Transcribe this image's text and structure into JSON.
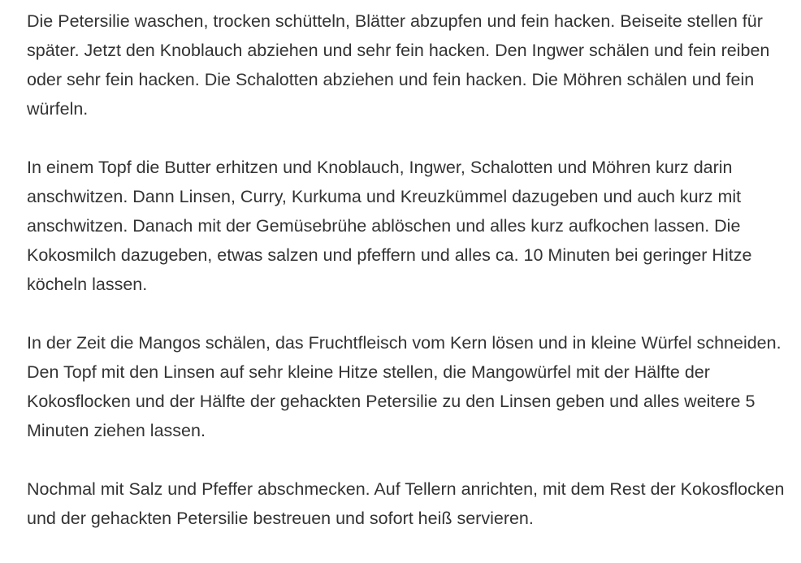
{
  "instructions": {
    "paragraphs": [
      "Die Petersilie waschen, trocken schütteln, Blätter abzupfen und fein hacken. Beiseite stellen für später. Jetzt den Knoblauch abziehen und sehr fein hacken. Den Ingwer schälen und fein reiben oder sehr fein hacken. Die Schalotten abziehen und fein hacken. Die Möhren schälen und fein würfeln.",
      "In einem Topf die Butter erhitzen und Knoblauch, Ingwer, Schalotten und Möhren kurz darin anschwitzen. Dann Linsen, Curry, Kurkuma und Kreuzkümmel dazugeben und auch kurz mit anschwitzen. Danach mit der Gemüsebrühe ablöschen und alles kurz aufkochen lassen. Die Kokosmilch dazugeben, etwas salzen und pfeffern und alles ca. 10 Minuten bei geringer Hitze köcheln lassen.",
      "In der Zeit die Mangos schälen, das Fruchtfleisch vom Kern lösen und in kleine Würfel schneiden. Den Topf mit den Linsen auf sehr kleine Hitze stellen, die Mangowürfel mit der Hälfte der Kokosflocken und der Hälfte der gehackten Petersilie zu den Linsen geben und alles weitere 5 Minuten ziehen lassen.",
      "Nochmal mit Salz und Pfeffer abschmecken. Auf Tellern anrichten, mit dem Rest der Kokosflocken und der gehackten Petersilie bestreuen und sofort heiß servieren."
    ]
  }
}
